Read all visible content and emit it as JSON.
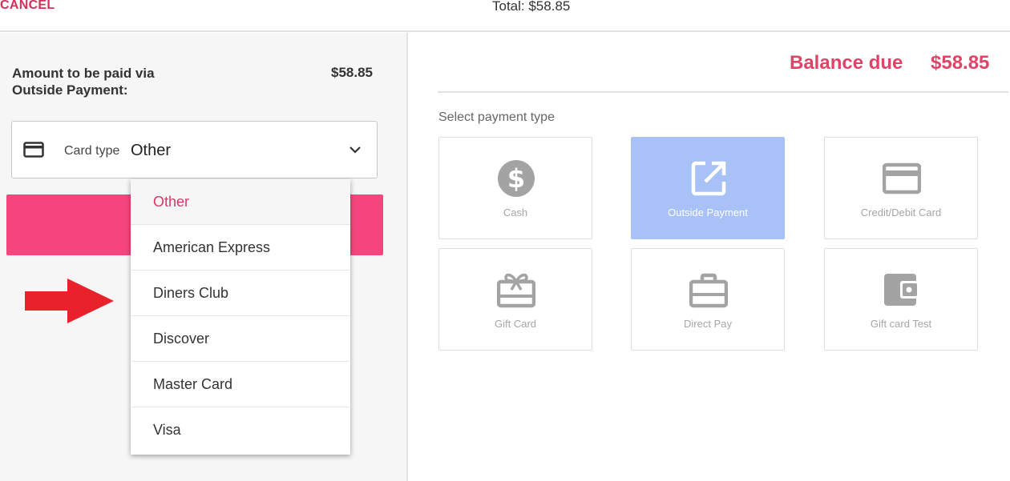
{
  "header": {
    "cancel_label": "CANCEL",
    "total_text": "Total: $58.85"
  },
  "left_panel": {
    "amount_label": "Amount to be paid via Outside Payment:",
    "amount_value": "$58.85",
    "card_type": {
      "label": "Card type",
      "value": "Other",
      "icon": "credit-card-icon",
      "chevron": "chevron-down-icon"
    },
    "dropdown_options": [
      {
        "label": "Other",
        "selected": true
      },
      {
        "label": "American Express",
        "selected": false
      },
      {
        "label": "Diners Club",
        "selected": false
      },
      {
        "label": "Discover",
        "selected": false
      },
      {
        "label": "Master Card",
        "selected": false
      },
      {
        "label": "Visa",
        "selected": false
      }
    ]
  },
  "right_panel": {
    "balance_label": "Balance due",
    "balance_value": "$58.85",
    "select_label": "Select payment type",
    "payment_types": [
      {
        "label": "Cash",
        "icon": "dollar-circle-icon",
        "active": false
      },
      {
        "label": "Outside Payment",
        "icon": "external-link-icon",
        "active": true
      },
      {
        "label": "Credit/Debit Card",
        "icon": "credit-card-icon",
        "active": false
      },
      {
        "label": "Gift Card",
        "icon": "gift-card-icon",
        "active": false
      },
      {
        "label": "Direct Pay",
        "icon": "briefcase-icon",
        "active": false
      },
      {
        "label": "Gift card Test",
        "icon": "wallet-icon",
        "active": false
      }
    ]
  },
  "colors": {
    "accent_pink": "#f5457c",
    "accent_text": "#e04366",
    "active_tile": "#a8c1f6",
    "annotation_arrow": "#e8212b"
  }
}
